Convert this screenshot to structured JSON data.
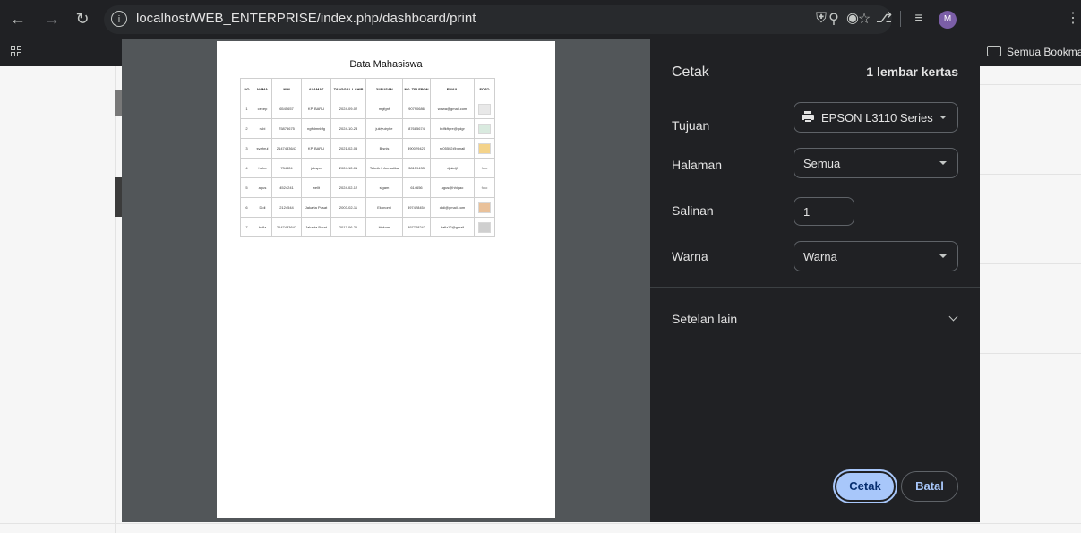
{
  "browser": {
    "url": "localhost/WEB_ENTERPRISE/index.php/dashboard/print",
    "avatar_letter": "M",
    "bookmarks_label": "Semua Bookmar"
  },
  "print_preview": {
    "title": "Data Mahasiswa",
    "columns": [
      "NO",
      "NAMA",
      "NIM",
      "ALAMAT",
      "TANGGAL LAHIR",
      "JURUSAN",
      "NO. TELEPON",
      "EMAIL",
      "FOTO"
    ],
    "rows": [
      {
        "no": "1",
        "nama": "cecep",
        "nim": "6545657",
        "alamat": "KP. BARU",
        "tanggal_lahir": "2024-09-02",
        "jurusan": "mgfgnf",
        "telepon": "90790686",
        "email": "wawa@gmail.com",
        "foto": "image"
      },
      {
        "no": "2",
        "nama": "rabi",
        "nim": "75875675",
        "alamat": "ngffdmnbfg",
        "tanggal_lahir": "2024-10-28",
        "jurusan": "jukiyuiryhe",
        "telepon": "87685674",
        "email": "bdfkftgre@gdgr",
        "foto": "image"
      },
      {
        "no": "3",
        "nama": "syahrul",
        "nim": "2147483647",
        "alamat": "KP. BARU",
        "tanggal_lahir": "2021-02-05",
        "jurusan": "Bisnis",
        "telepon": "390029421",
        "email": "ru05502@gmail",
        "foto": "image"
      },
      {
        "no": "4",
        "nama": "huhu",
        "nim": "734824",
        "alamat": "jakspo",
        "tanggal_lahir": "2024-12-01",
        "jurusan": "Teknik Informatika",
        "telepon": "38159433",
        "email": "djakdjf",
        "foto": "foto"
      },
      {
        "no": "5",
        "nama": "agus",
        "nim": "4524241",
        "alamat": "wellt",
        "tanggal_lahir": "2024-02-12",
        "jurusan": "sigam",
        "telepon": "614656",
        "email": "agus@hhigao",
        "foto": "foto"
      },
      {
        "no": "6",
        "nama": "Didi",
        "nim": "2124544",
        "alamat": "Jakarta Pusat",
        "tanggal_lahir": "2003-02-11",
        "jurusan": "Ekonomi",
        "telepon": "897428454",
        "email": "didi@gmail.com",
        "foto": "image"
      },
      {
        "no": "7",
        "nama": "hafiz",
        "nim": "2147483647",
        "alamat": "Jakarta Barat",
        "tanggal_lahir": "2017-06-21",
        "jurusan": "Hukum",
        "telepon": "897748242",
        "email": "hafiz12@gmail",
        "foto": "image"
      }
    ]
  },
  "settings": {
    "title": "Cetak",
    "sheets": "1 lembar kertas",
    "destination_label": "Tujuan",
    "destination_value": "EPSON L3110 Series",
    "pages_label": "Halaman",
    "pages_value": "Semua",
    "copies_label": "Salinan",
    "copies_value": "1",
    "color_label": "Warna",
    "color_value": "Warna",
    "more_settings": "Setelan lain",
    "print_button": "Cetak",
    "cancel_button": "Batal"
  }
}
